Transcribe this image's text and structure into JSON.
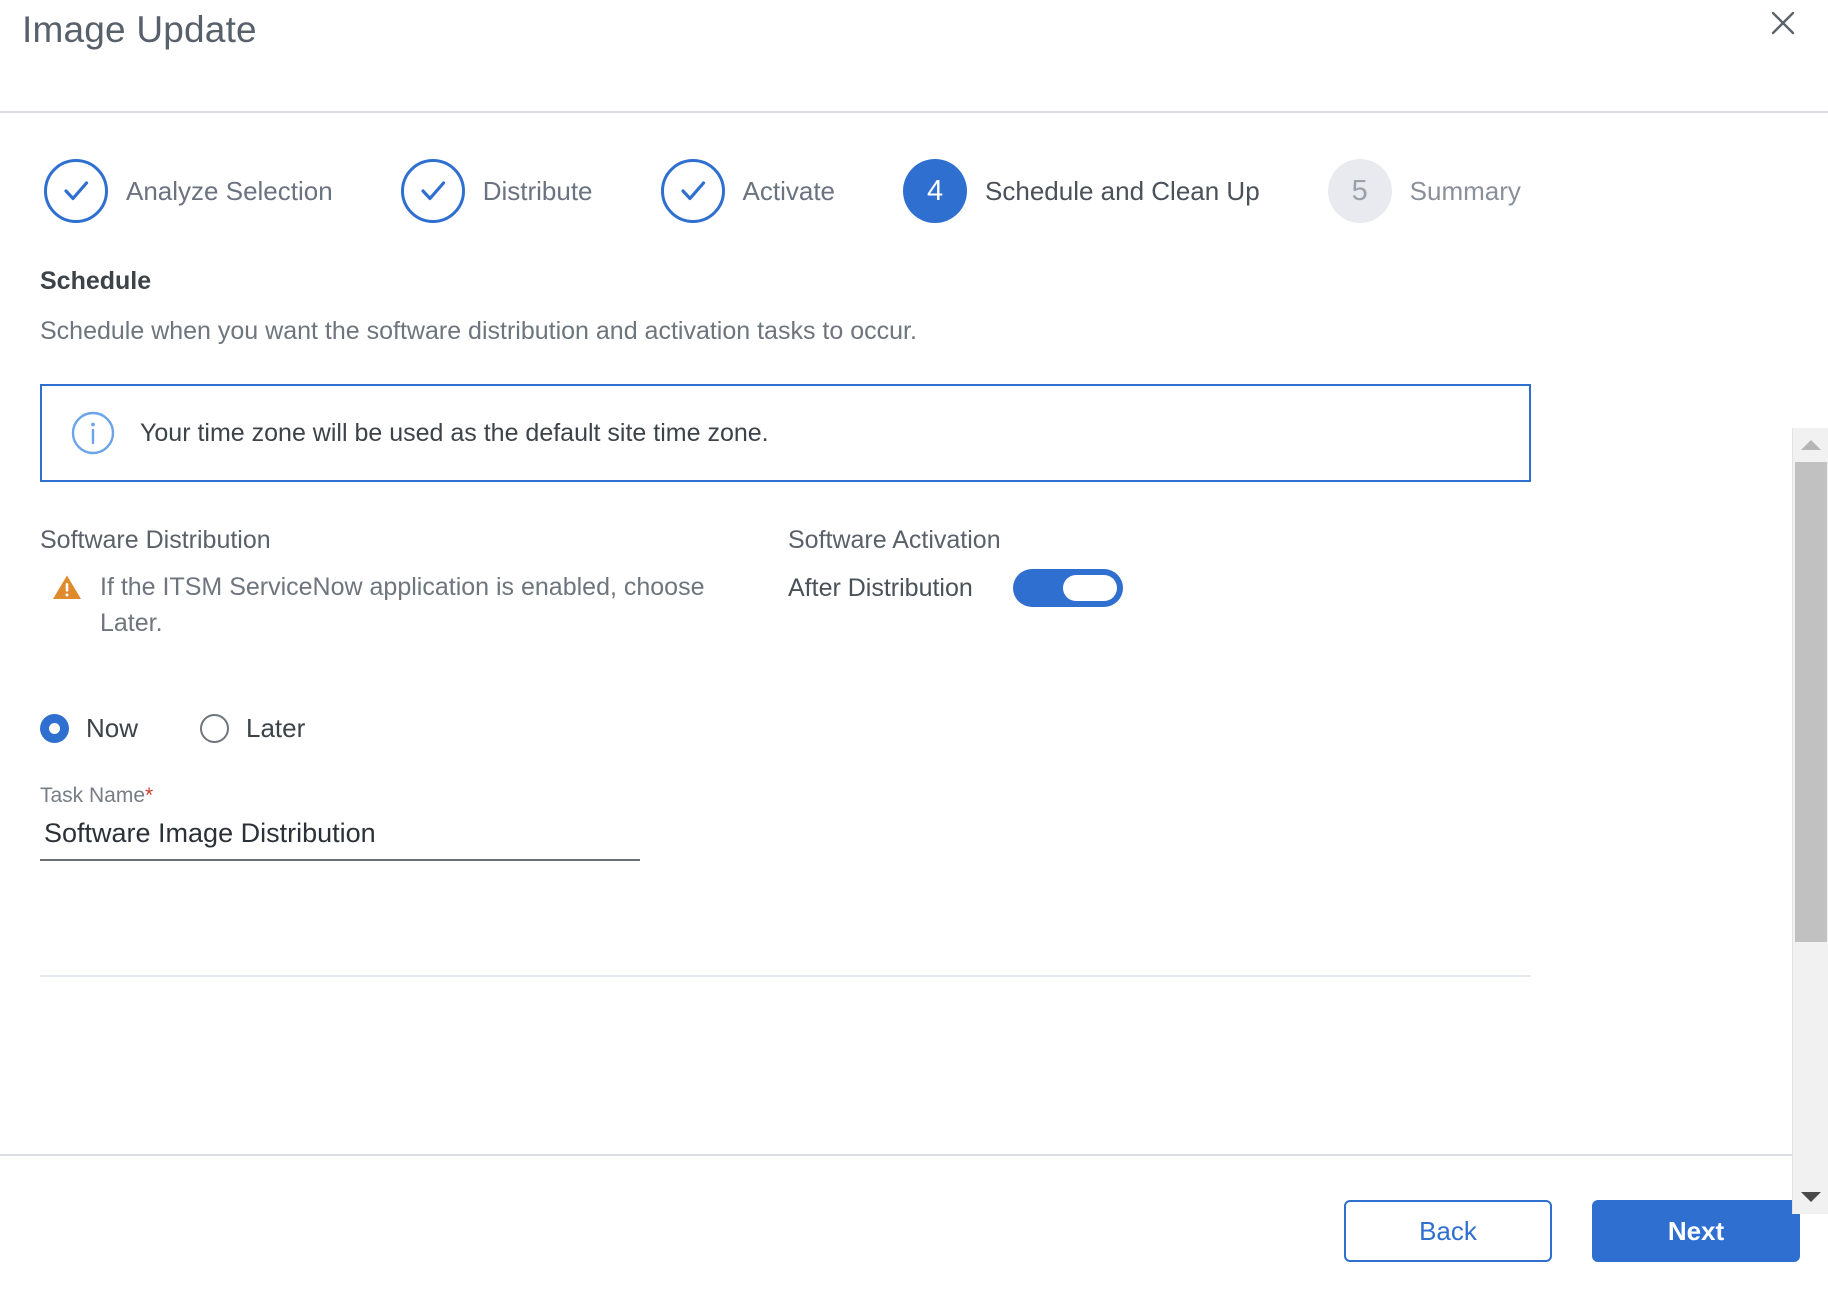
{
  "header": {
    "title": "Image Update",
    "close_icon": "close-icon"
  },
  "stepper": {
    "steps": [
      {
        "number": "1",
        "label": "Analyze Selection",
        "state": "done",
        "mark": "✓"
      },
      {
        "number": "2",
        "label": "Distribute",
        "state": "done",
        "mark": "✓"
      },
      {
        "number": "3",
        "label": "Activate",
        "state": "done",
        "mark": "✓"
      },
      {
        "number": "4",
        "label": "Schedule and Clean Up",
        "state": "active",
        "mark": "4"
      },
      {
        "number": "5",
        "label": "Summary",
        "state": "todo",
        "mark": "5"
      }
    ]
  },
  "schedule": {
    "title": "Schedule",
    "subtitle": "Schedule when you want the software distribution and activation tasks to occur.",
    "info_banner": {
      "icon": "info-circle-icon",
      "text": "Your time zone will be used as the default site time zone."
    }
  },
  "distribution": {
    "heading": "Software Distribution",
    "warning_icon": "warning-triangle-icon",
    "warning_text": "If the ITSM ServiceNow application is enabled, choose Later.",
    "options": [
      {
        "label": "Now",
        "selected": true
      },
      {
        "label": "Later",
        "selected": false
      }
    ],
    "task_name": {
      "label": "Task Name",
      "required_marker": "*",
      "value": "Software Image Distribution",
      "placeholder": "Task Name"
    }
  },
  "activation": {
    "heading": "Software Activation",
    "toggle_label": "After Distribution",
    "toggle_on": true
  },
  "scrollbar": {
    "up_icon": "chevron-up-icon",
    "down_icon": "chevron-down-icon"
  },
  "footer": {
    "back_label": "Back",
    "next_label": "Next"
  },
  "colors": {
    "accent_blue": "#2f6fd0",
    "warning_orange": "#e08a2e",
    "required_red": "#cf3b2e",
    "step_todo_bg": "#e8eaef",
    "text_primary": "#3c4349",
    "text_secondary": "#6e757d"
  }
}
